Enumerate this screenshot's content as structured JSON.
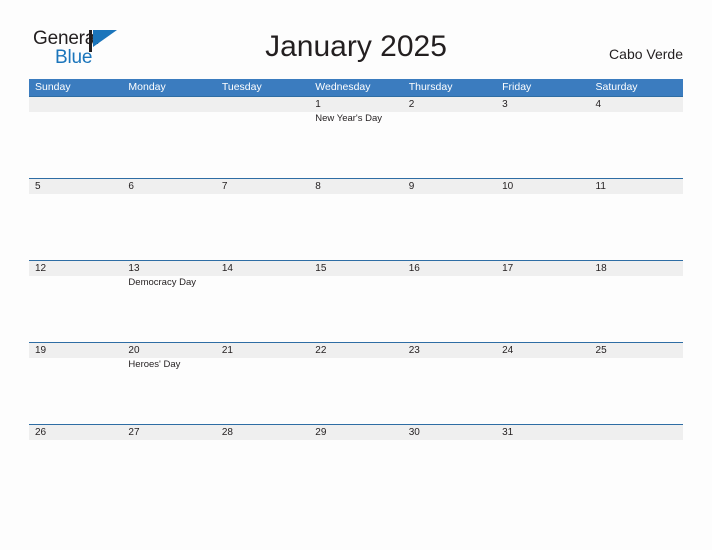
{
  "brand": {
    "name_part1": "General",
    "name_part2": "Blue",
    "flag_color": "#1b75bb"
  },
  "header": {
    "title": "January 2025",
    "country": "Cabo Verde"
  },
  "theme": {
    "header_blue": "#3b7cbf",
    "row_border_blue": "#2e6da4",
    "band_gray": "#efefef",
    "text_color": "#231f20",
    "page_background": "#fdfdfd"
  },
  "calendar": {
    "weekdays": [
      "Sunday",
      "Monday",
      "Tuesday",
      "Wednesday",
      "Thursday",
      "Friday",
      "Saturday"
    ],
    "weeks": [
      [
        {
          "day": "",
          "event": ""
        },
        {
          "day": "",
          "event": ""
        },
        {
          "day": "",
          "event": ""
        },
        {
          "day": "1",
          "event": "New Year's Day"
        },
        {
          "day": "2",
          "event": ""
        },
        {
          "day": "3",
          "event": ""
        },
        {
          "day": "4",
          "event": ""
        }
      ],
      [
        {
          "day": "5",
          "event": ""
        },
        {
          "day": "6",
          "event": ""
        },
        {
          "day": "7",
          "event": ""
        },
        {
          "day": "8",
          "event": ""
        },
        {
          "day": "9",
          "event": ""
        },
        {
          "day": "10",
          "event": ""
        },
        {
          "day": "11",
          "event": ""
        }
      ],
      [
        {
          "day": "12",
          "event": ""
        },
        {
          "day": "13",
          "event": "Democracy Day"
        },
        {
          "day": "14",
          "event": ""
        },
        {
          "day": "15",
          "event": ""
        },
        {
          "day": "16",
          "event": ""
        },
        {
          "day": "17",
          "event": ""
        },
        {
          "day": "18",
          "event": ""
        }
      ],
      [
        {
          "day": "19",
          "event": ""
        },
        {
          "day": "20",
          "event": "Heroes' Day"
        },
        {
          "day": "21",
          "event": ""
        },
        {
          "day": "22",
          "event": ""
        },
        {
          "day": "23",
          "event": ""
        },
        {
          "day": "24",
          "event": ""
        },
        {
          "day": "25",
          "event": ""
        }
      ],
      [
        {
          "day": "26",
          "event": ""
        },
        {
          "day": "27",
          "event": ""
        },
        {
          "day": "28",
          "event": ""
        },
        {
          "day": "29",
          "event": ""
        },
        {
          "day": "30",
          "event": ""
        },
        {
          "day": "31",
          "event": ""
        },
        {
          "day": "",
          "event": ""
        }
      ]
    ]
  }
}
